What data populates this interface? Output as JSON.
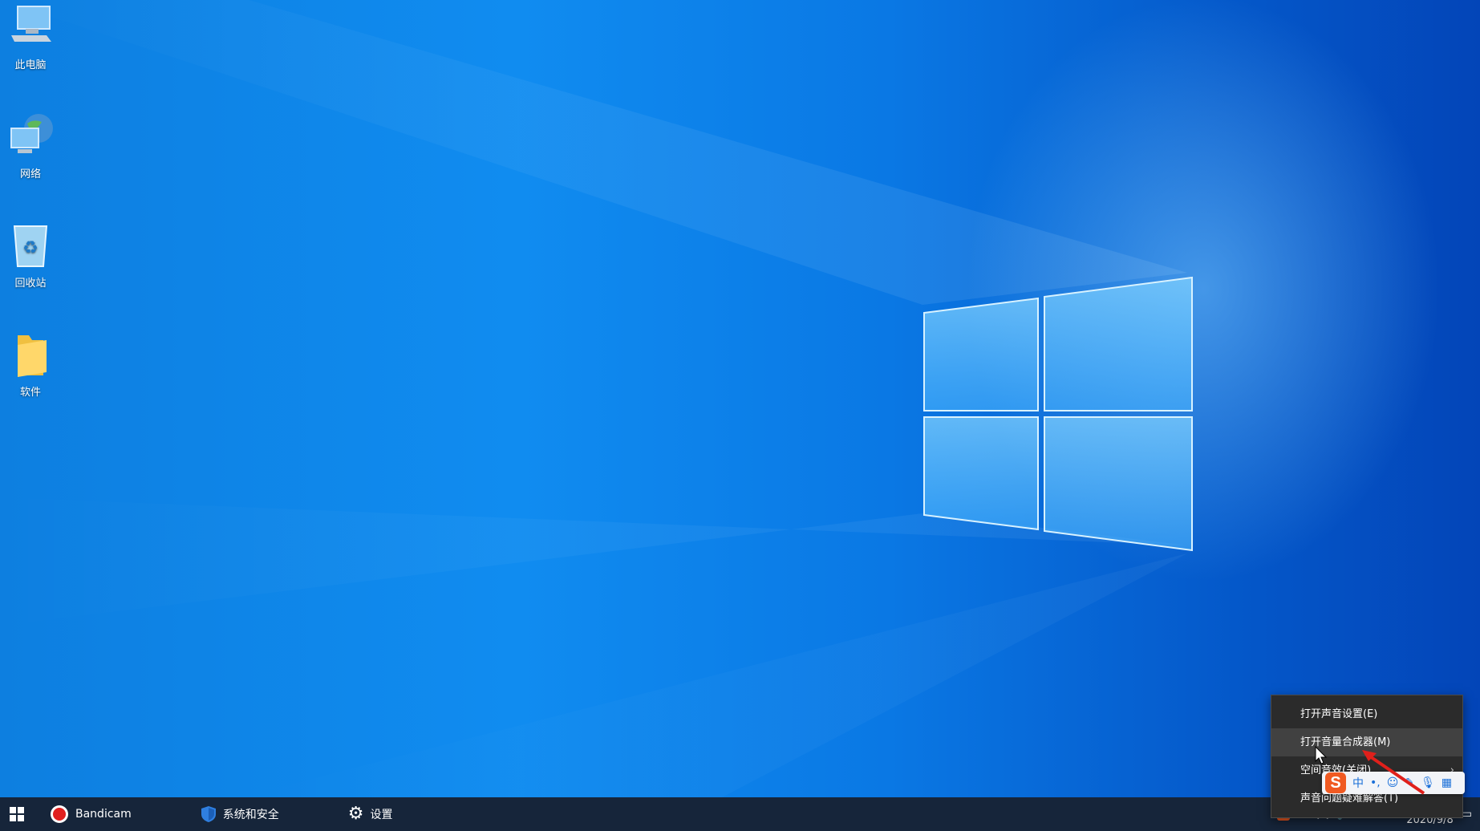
{
  "desktop": {
    "icons": [
      {
        "label": "此电脑",
        "icon": "this-pc-icon"
      },
      {
        "label": "网络",
        "icon": "network-icon"
      },
      {
        "label": "回收站",
        "icon": "recycle-bin-icon"
      },
      {
        "label": "软件",
        "icon": "folder-icon"
      }
    ]
  },
  "taskbar": {
    "apps": [
      {
        "label": "Bandicam",
        "icon": "bandicam-record-icon"
      },
      {
        "label": "系统和安全",
        "icon": "security-shield-icon"
      },
      {
        "label": "设置",
        "icon": "gear-icon"
      }
    ],
    "tray": {
      "date": "2020/9/8"
    }
  },
  "context_menu": {
    "items": [
      {
        "label": "打开声音设置(E)"
      },
      {
        "label": "打开音量合成器(M)"
      },
      {
        "label": "空间音效(关闭)"
      },
      {
        "label": "声音问题疑难解答(T)"
      }
    ]
  },
  "ime_toolbar": {
    "logo": "S",
    "mode": "中"
  },
  "colors": {
    "taskbar": "#16253a",
    "menu_bg": "#2b2b2b",
    "menu_hover": "#414141",
    "annotation_arrow": "#e0201b"
  }
}
